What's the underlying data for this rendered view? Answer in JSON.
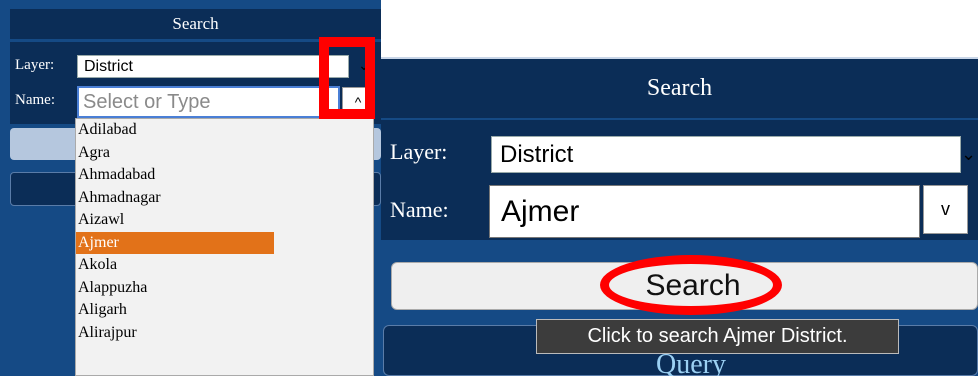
{
  "left_panel": {
    "title": "Search",
    "layer_label": "Layer:",
    "layer_value": "District",
    "name_label": "Name:",
    "name_placeholder": "Select or Type",
    "toggle_label": "^",
    "dropdown_items": [
      "Adilabad",
      "Agra",
      "Ahmadabad",
      "Ahmadnagar",
      "Aizawl",
      "Ajmer",
      "Akola",
      "Alappuzha",
      "Aligarh",
      "Alirajpur"
    ],
    "selected_item": "Ajmer"
  },
  "right_panel": {
    "title": "Search",
    "layer_label": "Layer:",
    "layer_value": "District",
    "name_label": "Name:",
    "name_value": "Ajmer",
    "toggle_label": "v",
    "search_button_label": "Search",
    "tooltip": "Click to search Ajmer District.",
    "query_label": "Query"
  },
  "colors": {
    "panel_dark": "#0b2d57",
    "panel_blue": "#154a85",
    "highlight": "#e27219",
    "annotation": "#ff0000"
  }
}
